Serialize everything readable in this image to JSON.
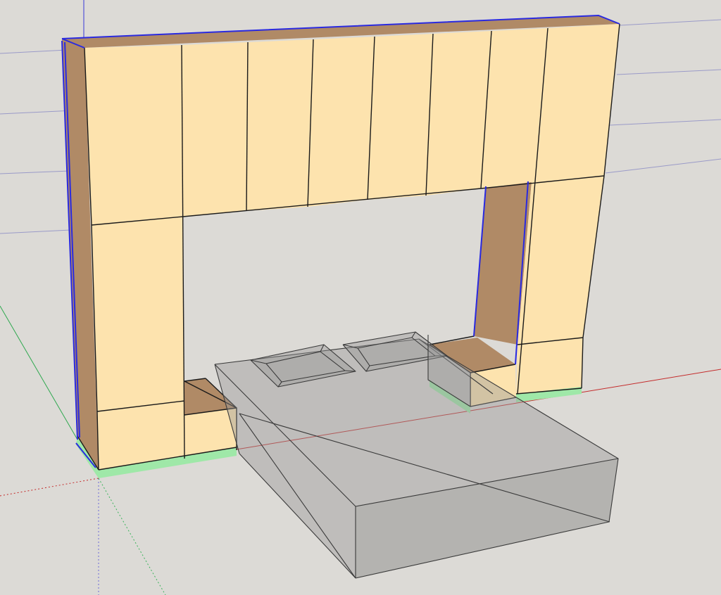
{
  "viewport": {
    "background": "#dcdad6",
    "axis_colors": {
      "red": "#c42b2b",
      "green": "#2fa84f",
      "blue": "#3838d8"
    },
    "material_colors": {
      "door_face": "#fde3ae",
      "carcass_side": "#b08a66",
      "plinth": "#9fe8a8",
      "selection": "#2a2ae0",
      "bed_translucent": "#9a9a9a"
    }
  },
  "scene": {
    "objects": [
      {
        "name": "wardrobe-bridge-unit",
        "selected": true
      },
      {
        "name": "bed",
        "translucent": true
      },
      {
        "name": "pillow-left"
      },
      {
        "name": "pillow-right"
      },
      {
        "name": "nightstand-left"
      },
      {
        "name": "nightstand-right"
      }
    ]
  }
}
